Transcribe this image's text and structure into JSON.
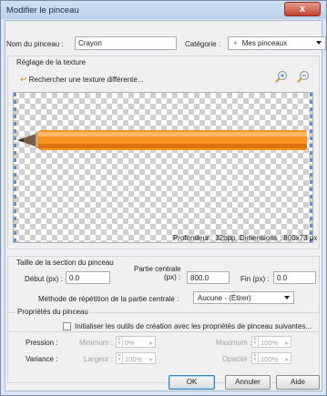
{
  "window": {
    "title": "Modifier le pinceau",
    "close_label": "x"
  },
  "brush": {
    "name_label": "Nom du pinceau :",
    "name_value": "Crayon",
    "category_label": "Catégorie :",
    "category_value": "Mes pinceaux",
    "category_icon": "star-icon"
  },
  "texture": {
    "group_label": "Réglage de la texture",
    "search_link": "Rechercher une texture différente...",
    "info": "Profondeur : 32bpp. Dimensions : 800x73 px",
    "zoom_in_icon": "zoom-in-icon",
    "zoom_out_icon": "zoom-out-icon"
  },
  "section": {
    "group_label": "Taille de la section du pinceau",
    "start_label": "Début (px) :",
    "start_value": "0.0",
    "center_label_1": "Partie centrale",
    "center_label_2": "(px) :",
    "center_value": "800.0",
    "end_label": "Fin (px) :",
    "end_value": "0.0",
    "repeat_label": "Méthode de répétition de la partie centrale :",
    "repeat_value": "Aucune - (Étirer)"
  },
  "properties": {
    "group_label": "Propriétés du pinceau",
    "init_checkbox_label": "Initialiser les outils de création avec les propriétés de pinceau suivantes...",
    "pressure_label": "Pression :",
    "variance_label": "Variance :",
    "min_label": "Minimum :",
    "min_value": "0%",
    "max_label": "Maximum :",
    "max_value": "100%",
    "width_label": "Largeur :",
    "width_value": "100%",
    "opacity_label": "Opacité :",
    "opacity_value": "100%"
  },
  "buttons": {
    "ok": "OK",
    "cancel": "Annuler",
    "help": "Aide"
  },
  "colors": {
    "accent": "#3c7fb1",
    "pencil_body": "#f7931e",
    "title_bg": "#cfe0f3"
  }
}
